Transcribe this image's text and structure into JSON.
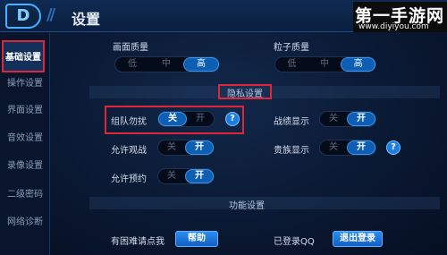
{
  "header": {
    "back_glyph": "D",
    "slashes": "//",
    "title": "设置",
    "watermark": {
      "name": "第一手游网",
      "url": "www.diyiyou.com"
    }
  },
  "sidebar": {
    "items": [
      {
        "label": "基础设置",
        "active": true
      },
      {
        "label": "操作设置"
      },
      {
        "label": "界面设置"
      },
      {
        "label": "音效设置"
      },
      {
        "label": "录像设置"
      },
      {
        "label": "二级密码"
      },
      {
        "label": "网络诊断"
      }
    ]
  },
  "quality": {
    "screen": {
      "label": "画面质量",
      "options": [
        "低",
        "中",
        "高"
      ],
      "selected": "高"
    },
    "particle": {
      "label": "粒子质量",
      "options": [
        "低",
        "中",
        "高"
      ],
      "selected": "高"
    }
  },
  "privacy": {
    "title": "隐私设置",
    "team_dnd": {
      "label": "组队勿扰",
      "off": "关",
      "on": "开",
      "value": "关",
      "help": "?"
    },
    "record_display": {
      "label": "战绩显示",
      "off": "关",
      "on": "开",
      "value": "开"
    },
    "allow_watch": {
      "label": "允许观战",
      "off": "关",
      "on": "开",
      "value": "开"
    },
    "noble_display": {
      "label": "贵族显示",
      "off": "关",
      "on": "开",
      "value": "开",
      "help": "?"
    },
    "allow_reserve": {
      "label": "允许预约",
      "off": "关",
      "on": "开",
      "value": "开"
    }
  },
  "function": {
    "title": "功能设置",
    "help_prompt": "有困难请点我",
    "help_button": "帮助",
    "login_status": "已登录QQ",
    "logout_button": "退出登录"
  },
  "colors": {
    "accent": "#0e5fb3",
    "highlight": "#e0263a",
    "background": "#0a1933"
  }
}
